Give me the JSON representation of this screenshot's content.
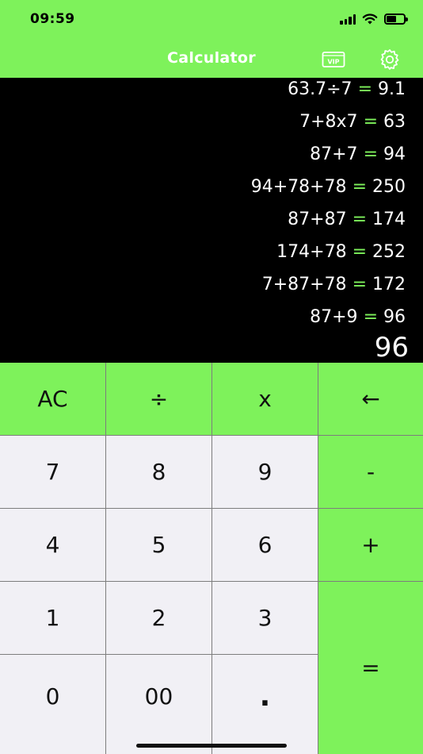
{
  "status_bar": {
    "time": "09:59"
  },
  "nav": {
    "title": "Calculator",
    "vip_label": "VIP"
  },
  "history": [
    {
      "expr": "63.7÷7",
      "eq": "=",
      "result": "9.1"
    },
    {
      "expr": "7+8x7",
      "eq": "=",
      "result": "63"
    },
    {
      "expr": "87+7",
      "eq": "=",
      "result": "94"
    },
    {
      "expr": "94+78+78",
      "eq": "=",
      "result": "250"
    },
    {
      "expr": "87+87",
      "eq": "=",
      "result": "174"
    },
    {
      "expr": "174+78",
      "eq": "=",
      "result": "252"
    },
    {
      "expr": "7+87+78",
      "eq": "=",
      "result": "172"
    },
    {
      "expr": "87+9",
      "eq": "=",
      "result": "96"
    }
  ],
  "display": {
    "value": "96"
  },
  "keys": {
    "ac": "AC",
    "divide": "÷",
    "multiply": "x",
    "backspace": "←",
    "seven": "7",
    "eight": "8",
    "nine": "9",
    "minus": "-",
    "four": "4",
    "five": "5",
    "six": "6",
    "plus": "+",
    "one": "1",
    "two": "2",
    "three": "3",
    "equals": "=",
    "zero": "0",
    "double_zero": "00",
    "decimal": "."
  },
  "colors": {
    "accent": "#7ef25b",
    "key_light": "#f1f0f5",
    "display_bg": "#000000"
  }
}
